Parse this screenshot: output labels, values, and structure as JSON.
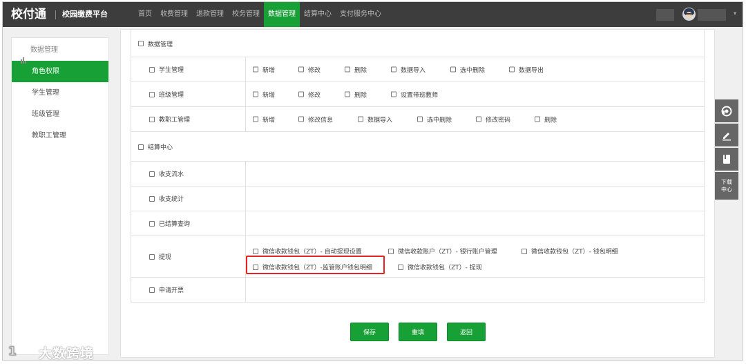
{
  "app": {
    "logo_text": "校付通",
    "platform_name": "校园缴费平台"
  },
  "nav": [
    {
      "label": "首页",
      "active": false
    },
    {
      "label": "收费管理",
      "active": false
    },
    {
      "label": "退款管理",
      "active": false
    },
    {
      "label": "校务管理",
      "active": false
    },
    {
      "label": "数据管理",
      "active": true
    },
    {
      "label": "结算中心",
      "active": false
    },
    {
      "label": "支付服务中心",
      "active": false
    }
  ],
  "sidebar": {
    "header": "数据管理",
    "items": [
      {
        "label": "角色权限",
        "active": true
      },
      {
        "label": "学生管理",
        "active": false
      },
      {
        "label": "班级管理",
        "active": false
      },
      {
        "label": "教职工管理",
        "active": false
      }
    ]
  },
  "permissions": {
    "group_data": "数据管理",
    "student_mgmt": {
      "label": "学生管理",
      "perms": [
        "新增",
        "修改",
        "删除",
        "数据导入",
        "选中删除",
        "数据导出"
      ]
    },
    "class_mgmt": {
      "label": "班级管理",
      "perms": [
        "新增",
        "修改",
        "删除",
        "设置带班教师"
      ]
    },
    "staff_mgmt": {
      "label": "教职工管理",
      "perms": [
        "新增",
        "修改信息",
        "数据导入",
        "选中删除",
        "修改密码",
        "删除"
      ]
    },
    "group_settlement": "结算中心",
    "income_flow": {
      "label": "收支流水"
    },
    "income_stats": {
      "label": "收支统计"
    },
    "settled_query": {
      "label": "已结算查询"
    },
    "withdraw": {
      "label": "提现",
      "perms": [
        "微信收款钱包（ZT）- 自动提现设置",
        "微信收款账户（ZT）- 银行账户管理",
        "微信收款钱包（ZT）- 钱包明细",
        "微信收款钱包（ZT）-监管账户钱包明细",
        "微信收款钱包（ZT）- 提现"
      ]
    },
    "invoice": {
      "label": "申请开票"
    }
  },
  "buttons": {
    "save": "保存",
    "reset": "重填",
    "back": "返回"
  },
  "right_tools": {
    "service_icon": "headset-icon",
    "edit_icon": "pen-icon",
    "book_icon": "book-icon",
    "download_center": "下载中心"
  },
  "watermark": "大数跨境",
  "colors": {
    "accent": "#17a035",
    "topbar": "#3d3d3d",
    "highlight": "#e02424"
  }
}
